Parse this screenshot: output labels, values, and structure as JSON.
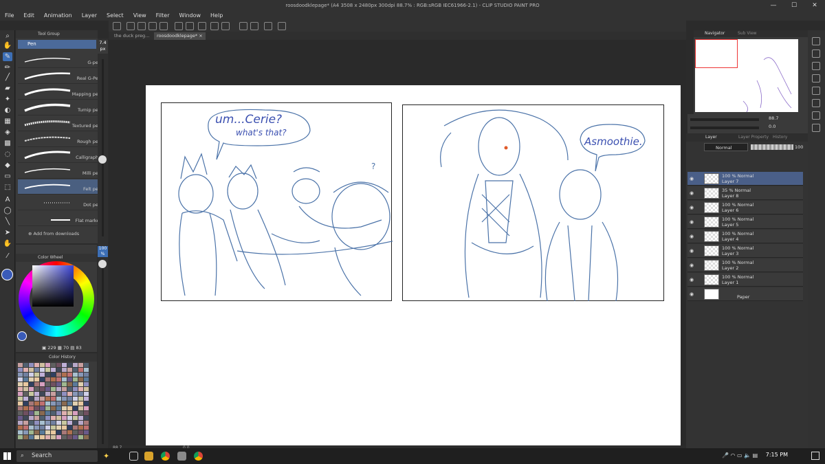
{
  "window": {
    "title": "roosdoodklepage* (A4 3508 x 2480px 300dpi 88.7% : RGB:sRGB IEC61966-2.1) - CLIP STUDIO PAINT PRO"
  },
  "menu": [
    "File",
    "Edit",
    "Animation",
    "Layer",
    "Select",
    "View",
    "Filter",
    "Window",
    "Help"
  ],
  "subtool": {
    "group_label": "Tool Group",
    "tab_label": "Pen",
    "brushes": [
      "G-pen",
      "Real G-Pen",
      "Mapping pen",
      "Turnip pen",
      "Textured pen",
      "Rough pen",
      "Calligraphy",
      "Milli pen",
      "Felt pen",
      "Dot pen",
      "Flat marker"
    ],
    "selected_brush": "Felt pen",
    "add_label": "Add from downloads"
  },
  "brush_size": {
    "value": "7.4",
    "unit": "px"
  },
  "opacity": {
    "value": "100",
    "unit": "%"
  },
  "color_wheel": {
    "label": "Color Wheel",
    "r": "229",
    "g": "70",
    "b": "83",
    "color": "#3a5bb8"
  },
  "color_history": {
    "label": "Color History"
  },
  "doc_tabs": [
    "the duck preg...",
    "roosdoodklepage*"
  ],
  "canvas": {
    "bubble1_line1": "um...Cerie?",
    "bubble1_line2": "what's that?",
    "bubble2": "Asmoothie."
  },
  "status": {
    "zoom": "88.7",
    "angle": "0.0"
  },
  "navigator": {
    "tab1": "Navigator",
    "tab2": "Sub View",
    "zoom": "88.7",
    "rotate": "0.0"
  },
  "layer_panel": {
    "tab1": "Layer",
    "tab2": "Layer Property",
    "tab3": "History",
    "blend": "Normal",
    "opacity": "100",
    "layers": [
      {
        "pct": "100 % Normal",
        "name": "Layer 7",
        "selected": true
      },
      {
        "pct": "35 % Normal",
        "name": "Layer 8"
      },
      {
        "pct": "100 % Normal",
        "name": "Layer 6"
      },
      {
        "pct": "100 % Normal",
        "name": "Layer 5"
      },
      {
        "pct": "100 % Normal",
        "name": "Layer 4"
      },
      {
        "pct": "100 % Normal",
        "name": "Layer 3"
      },
      {
        "pct": "100 % Normal",
        "name": "Layer 2"
      },
      {
        "pct": "100 % Normal",
        "name": "Layer 1"
      },
      {
        "pct": "",
        "name": "Paper"
      }
    ]
  },
  "taskbar": {
    "search": "Search",
    "time": "7:15 PM"
  }
}
